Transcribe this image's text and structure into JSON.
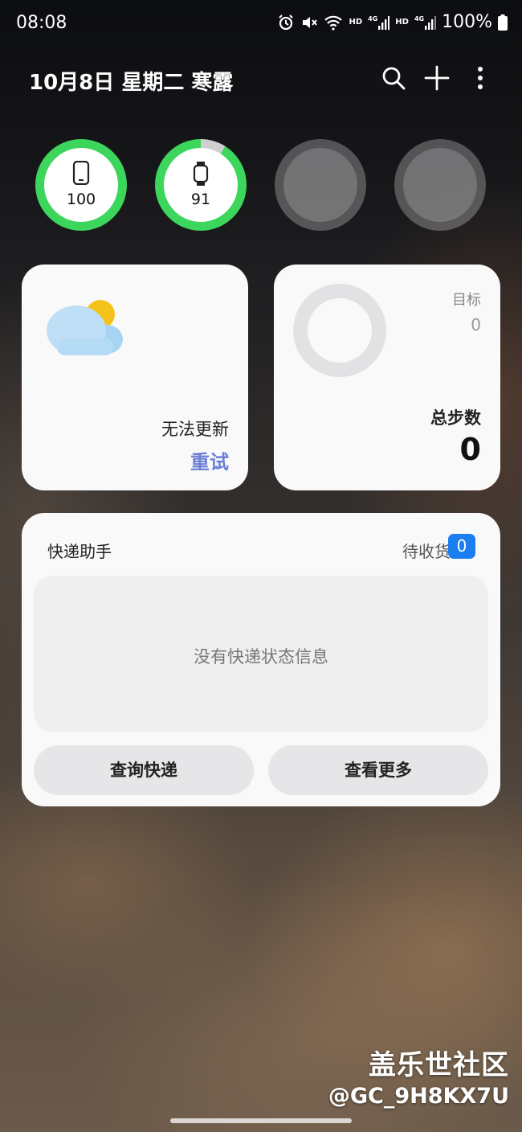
{
  "status_bar": {
    "time": "08:08",
    "icons": [
      "alarm-icon",
      "mute-icon",
      "wifi-icon",
      "volte-hd-icon",
      "signal-4g-icon",
      "volte-hd-icon",
      "signal-4g-icon",
      "battery-icon"
    ],
    "hd1": "HD",
    "net1": "4G",
    "hd2": "HD",
    "net2": "4G",
    "battery": "100%"
  },
  "header": {
    "date": "10月8日 星期二 寒露",
    "actions": [
      "search-icon",
      "plus-icon",
      "more-icon"
    ]
  },
  "devices": [
    {
      "icon": "phone-icon",
      "value": "100",
      "level": 100
    },
    {
      "icon": "watch-icon",
      "value": "91",
      "level": 91
    },
    {
      "icon": "",
      "value": "",
      "level": 0
    },
    {
      "icon": "",
      "value": "",
      "level": 0
    }
  ],
  "weather": {
    "status": "无法更新",
    "retry": "重试"
  },
  "steps": {
    "goal_label": "目标",
    "goal_value": "0",
    "total_label": "总步数",
    "total_value": "0"
  },
  "express": {
    "title": "快递助手",
    "pending_label": "待收货",
    "pending_count": "0",
    "empty_text": "没有快递状态信息",
    "query_button": "查询快递",
    "more_button": "查看更多"
  },
  "watermark": {
    "line1": "盖乐世社区",
    "line2": "@GC_9H8KX7U"
  },
  "colors": {
    "ring_green": "#3dd65c",
    "ring_track": "#cfcfcf",
    "accent_blue": "#1a7ef0",
    "retry_blue": "#6b7fd4"
  }
}
